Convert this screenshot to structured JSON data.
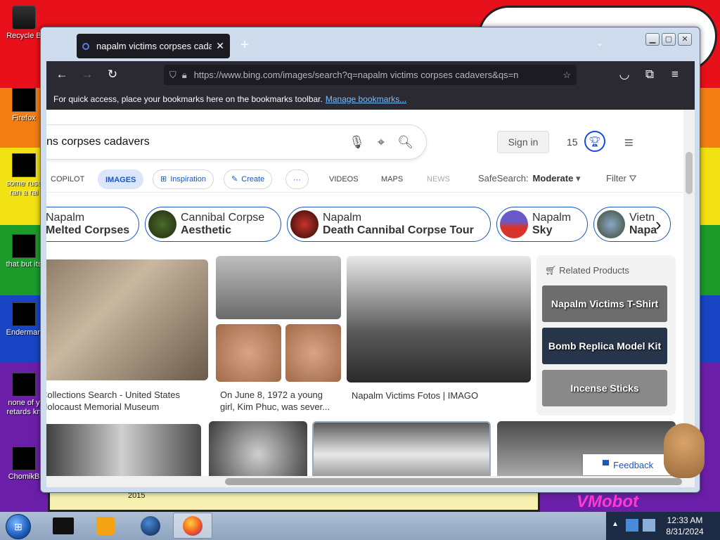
{
  "desktop": {
    "icons": [
      {
        "label": "Recycle B"
      },
      {
        "label": "Firefox"
      },
      {
        "label": "some russ ran a rai"
      },
      {
        "label": "that but its"
      },
      {
        "label": "Enderman"
      },
      {
        "label": "none of y retards kn"
      },
      {
        "label": "ChomikB"
      }
    ],
    "bottom_text": "2015",
    "watermark": "VMobot"
  },
  "browser": {
    "tab_title": "napalm victims corpses cadavers",
    "tab_close": "✕",
    "new_tab": "+",
    "url": "https://www.bing.com/images/search?q=napalm victims corpses cadavers&qs=n",
    "bookmarks_hint": "For quick access, place your bookmarks here on the bookmarks toolbar.",
    "manage_bookmarks": "Manage bookmarks..."
  },
  "bing": {
    "query": "ns corpses cadavers",
    "sign_in": "Sign in",
    "rewards_count": "15",
    "scopes": [
      {
        "label": "COPILOT"
      },
      {
        "label": "IMAGES"
      },
      {
        "label": "Inspiration"
      },
      {
        "label": "Create"
      },
      {
        "label": "···"
      },
      {
        "label": "VIDEOS"
      },
      {
        "label": "MAPS"
      },
      {
        "label": "NEWS"
      }
    ],
    "safesearch_label": "SafeSearch:",
    "safesearch_value": "Moderate",
    "filter_label": "Filter",
    "chips": [
      {
        "line1": "Napalm",
        "line2": "Melted Corpses"
      },
      {
        "line1": "Cannibal Corpse",
        "line2": "Aesthetic"
      },
      {
        "line1": "Napalm",
        "line2": "Death Cannibal Corpse Tour"
      },
      {
        "line1": "Napalm",
        "line2": "Sky"
      },
      {
        "line1": "Vietn",
        "line2": "Napa"
      }
    ],
    "results": [
      {
        "caption": "Collections Search - United States Holocaust Memorial Museum"
      },
      {
        "caption": "On June 8, 1972 a young girl, Kim Phuc, was sever..."
      },
      {
        "caption": "Napalm Victims Fotos | IMAGO"
      }
    ],
    "related_title": "Related Products",
    "products": [
      {
        "label": "Napalm Victims T-Shirt",
        "color": "#6d6d6d"
      },
      {
        "label": "Bomb Replica Model Kit",
        "color": "#26354a"
      },
      {
        "label": "Incense Sticks",
        "color": "#8a8a8a"
      }
    ],
    "feedback": "Feedback"
  },
  "taskbar": {
    "start": "⊞",
    "time": "12:33 AM",
    "date": "8/31/2024"
  }
}
